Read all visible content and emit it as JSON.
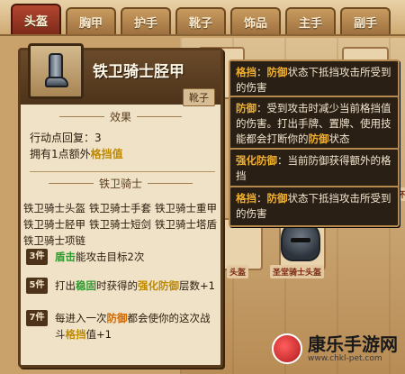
{
  "tabs": [
    "头盔",
    "胸甲",
    "护手",
    "靴子",
    "饰品",
    "主手",
    "副手"
  ],
  "active_tab": 0,
  "item": {
    "name": "铁卫骑士胫甲",
    "slot": "靴子",
    "icon": "greave-icon"
  },
  "effects": {
    "title": "效果",
    "line1": "行动点回复：3",
    "line2_prefix": "拥有1点额外",
    "line2_keyword": "格挡值"
  },
  "set": {
    "title": "铁卫骑士",
    "pieces": [
      "铁卫骑士头盔",
      "铁卫骑士手套",
      "铁卫骑士重甲",
      "铁卫骑士胫甲",
      "铁卫骑士短剑",
      "铁卫骑士塔盾",
      "铁卫骑士项链"
    ],
    "bonus3": {
      "tag": "3件",
      "keyword": "盾击",
      "text": "能攻击目标2次"
    },
    "bonus5": {
      "tag": "5件",
      "prefix": "打出",
      "keyword1": "稳固",
      "mid": "时获得的",
      "keyword2": "强化防御",
      "suffix": "层数+1"
    },
    "bonus7": {
      "tag": "7件",
      "prefix": "每进入一次",
      "keyword1": "防御",
      "mid": "都会使你的这次战斗",
      "keyword2": "格挡",
      "suffix": "值+1"
    }
  },
  "tooltips": [
    {
      "keyword": "格挡",
      "text": "：",
      "keyword2": "防御",
      "text2": "状态下抵挡攻击所受到的伤害"
    },
    {
      "keyword": "防御",
      "text": "：受到攻击时减少当前格挡值的伤害。打出手牌、置牌、使用技能都会打断你的",
      "keyword2": "防御",
      "text2": "状态"
    },
    {
      "keyword": "强化防御",
      "text": "：当前防御获得额外的格挡",
      "keyword2": "",
      "text2": ""
    },
    {
      "keyword": "格挡",
      "text": "：",
      "keyword2": "防御",
      "text2": "状态下抵挡攻击所受到的伤害"
    }
  ],
  "background": {
    "labels": [
      "头盔",
      "圣堂骑士头盔",
      "杯"
    ]
  },
  "watermark": {
    "title": "康乐手游网",
    "url": "www.chkl-pet.com"
  },
  "colors": {
    "active_tab": "#9a3623",
    "keyword": "#f0b030",
    "highlight_yellow": "#c08a00",
    "highlight_green": "#2f9a2f"
  }
}
